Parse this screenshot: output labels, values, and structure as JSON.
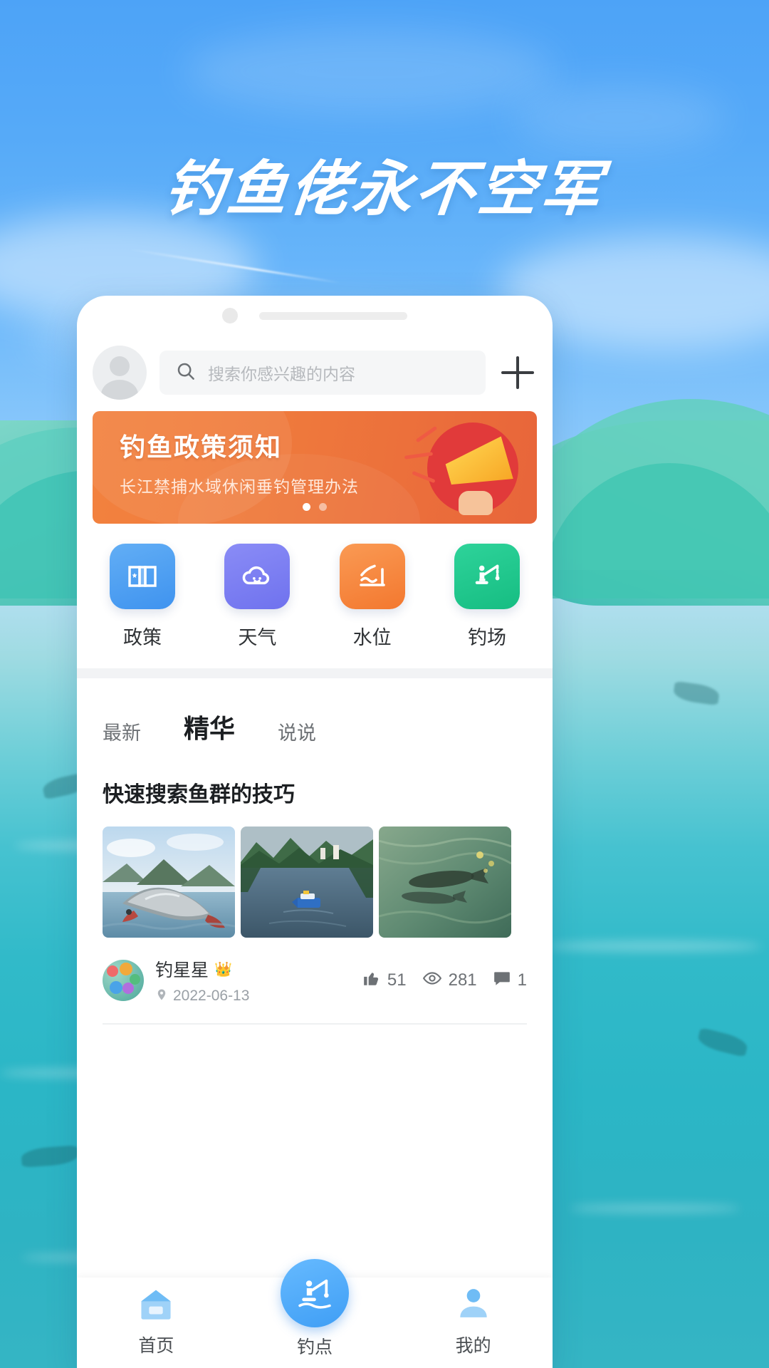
{
  "hero": {
    "headline": "钓鱼佬永不空军"
  },
  "app": {
    "search": {
      "placeholder": "搜索你感兴趣的内容",
      "search_icon": "search-icon",
      "add_icon": "plus-icon",
      "avatar_alt": "用户头像"
    },
    "banner": {
      "title": "钓鱼政策须知",
      "subtitle": "长江禁捕水域休闲垂钓管理办法",
      "dots": 2,
      "active_dot": 0,
      "bg_color": "#ef7a3c",
      "megaphone_icon": "megaphone-icon"
    },
    "grid": [
      {
        "label": "政策",
        "icon": "book-icon",
        "color": "#4a9cf0"
      },
      {
        "label": "天气",
        "icon": "cloud-icon",
        "color": "#7a7df0"
      },
      {
        "label": "水位",
        "icon": "chart-icon",
        "color": "#f5853f"
      },
      {
        "label": "钓场",
        "icon": "angler-icon",
        "color": "#22c08a"
      }
    ],
    "tabs": [
      {
        "label": "最新",
        "active": false
      },
      {
        "label": "精华",
        "active": true
      },
      {
        "label": "说说",
        "active": false
      }
    ],
    "post": {
      "title": "快速搜索鱼群的技巧",
      "thumbnails": [
        {
          "alt": "跳跃的鱼"
        },
        {
          "alt": "湖面上的渔船"
        },
        {
          "alt": "水下游动的鱼"
        }
      ],
      "author": "钓星星",
      "author_badge": "👑",
      "date": "2022-06-13",
      "location_icon": "pin-icon",
      "stats": [
        {
          "icon": "thumb-up-icon",
          "value": "51"
        },
        {
          "icon": "eye-icon",
          "value": "281"
        },
        {
          "icon": "comment-icon",
          "value": "1"
        }
      ]
    },
    "bottom_nav": [
      {
        "label": "首页",
        "icon": "home-icon",
        "active": true
      },
      {
        "label": "钓点",
        "icon": "angler-icon",
        "active": false,
        "center": true
      },
      {
        "label": "我的",
        "icon": "person-icon",
        "active": false
      }
    ]
  }
}
